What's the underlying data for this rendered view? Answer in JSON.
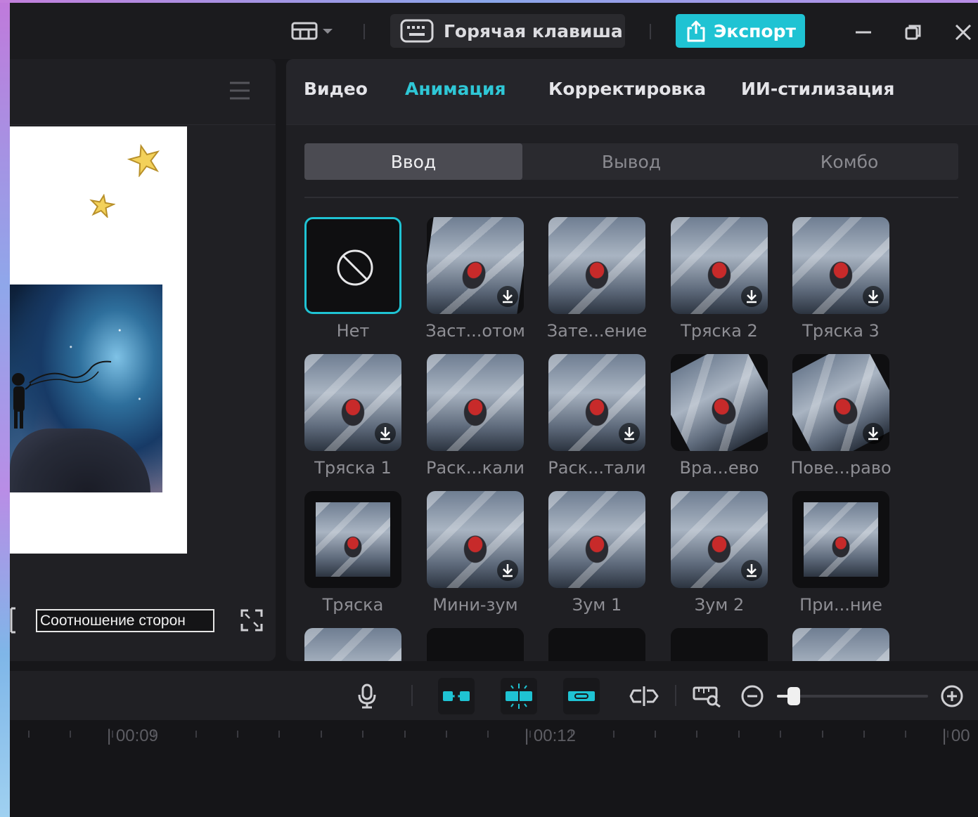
{
  "titlebar": {
    "hotkey_label": "Горячая клавиша",
    "export_label": "Экспорт",
    "icons": [
      "layout-icon",
      "chevron-down-icon",
      "keyboard-icon",
      "export-icon",
      "minimize-icon",
      "restore-icon",
      "close-icon"
    ]
  },
  "player": {
    "aspect_label": "Соотношение сторон"
  },
  "tabs": [
    {
      "label": "Видео",
      "active": false
    },
    {
      "label": "Анимация",
      "active": true
    },
    {
      "label": "Корректировка",
      "active": false
    },
    {
      "label": "ИИ-стилизация",
      "active": false
    }
  ],
  "subtabs": [
    {
      "label": "Ввод",
      "active": true
    },
    {
      "label": "Вывод",
      "active": false
    },
    {
      "label": "Комбо",
      "active": false
    }
  ],
  "animations": [
    {
      "label": "Нет",
      "selected": true,
      "download": false,
      "none": true
    },
    {
      "label": "Заст...отом",
      "download": true
    },
    {
      "label": "Зате...ение",
      "download": false
    },
    {
      "label": "Тряска 2",
      "download": true
    },
    {
      "label": "Тряска 3",
      "download": true
    },
    {
      "label": "Тряска 1",
      "download": true
    },
    {
      "label": "Раск...кали",
      "download": false
    },
    {
      "label": "Раск...тали",
      "download": true
    },
    {
      "label": "Вра...ево",
      "download": false
    },
    {
      "label": "Пове...раво",
      "download": true
    },
    {
      "label": "Тряска",
      "download": false
    },
    {
      "label": "Мини-зум",
      "download": true
    },
    {
      "label": "Зум 1",
      "download": false
    },
    {
      "label": "Зум 2",
      "download": true
    },
    {
      "label": "При...ние",
      "download": false
    }
  ],
  "timeline": {
    "time_labels": [
      "| 00:09",
      "| 00:12",
      "| 00"
    ],
    "zoom_level": 0.07,
    "accent_color": "#1fc3d3"
  },
  "colors": {
    "accent": "#1fc3d3",
    "export_button": "#1fc3d3",
    "panel_bg": "#1f1f23"
  }
}
